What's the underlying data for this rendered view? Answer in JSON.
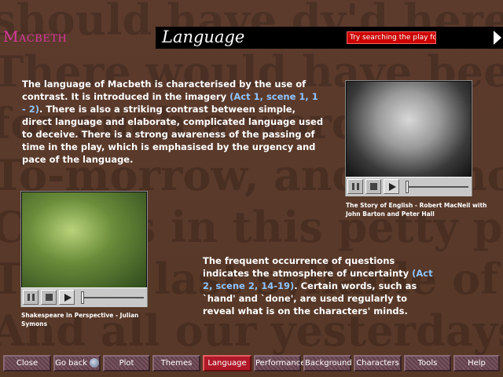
{
  "app": {
    "title": "Macbeth"
  },
  "watermark_lines": [
    "should have dy'd hereafter",
    "There would have been a time",
    "for such a word.",
    "To-morrow, and to-morrow,",
    "Creeps in this petty pace from day to day",
    "To the last syllable of Recorded time,",
    "And all our yesterdays have lighted"
  ],
  "header": {
    "label": "Language",
    "search_label": "Try searching the play for ..."
  },
  "paragraph1": {
    "text_a": "The language of Macbeth is characterised by the use of contrast. It is introduced in the imagery ",
    "link": "(Act 1, scene 1, 1 - 2)",
    "text_b": ".  There is also a striking contrast between simple, direct language and elaborate, complicated language used to deceive.  There is a strong awareness of the passing of time in the play, which is emphasised by the urgency and pace of the language."
  },
  "paragraph2": {
    "text_a": "The frequent occurrence of questions indicates the atmosphere of uncertainty ",
    "link": "(Act 2, scene 2, 14-19)",
    "text_b": ". Certain words, such as `hand' and `done', are used regularly to reveal what is on the characters' minds."
  },
  "videos": [
    {
      "caption": "The Story of English - Robert MacNeil with John Barton and Peter Hall",
      "progress": 0
    },
    {
      "caption": "Shakespeare in Perspective - Julian Symons",
      "progress": 0
    }
  ],
  "nav": [
    "Close",
    "Go back",
    "Plot",
    "Themes",
    "Language",
    "Performance",
    "Background",
    "Characters",
    "Tools",
    "Help"
  ],
  "colors": {
    "title": "#d8379d",
    "link": "#8fc4ff",
    "active_nav": "#b01828"
  }
}
